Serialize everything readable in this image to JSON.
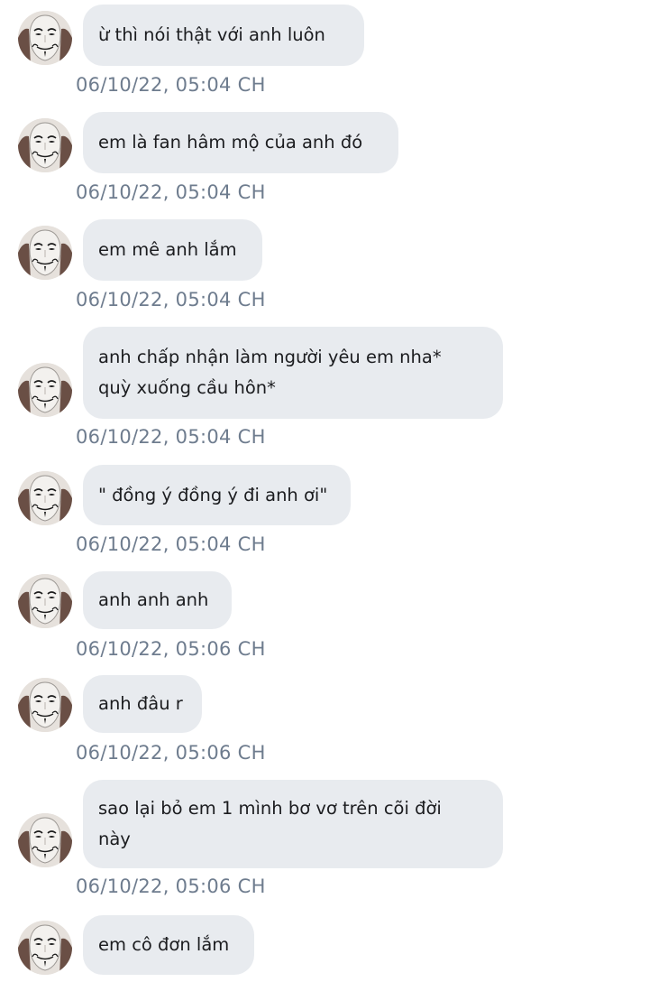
{
  "messages": [
    {
      "text": "ừ thì nói thật với anh luôn",
      "time": "06/10/22,  05:04 CH"
    },
    {
      "text": "em là fan hâm mộ của anh đó",
      "time": "06/10/22,  05:04 CH"
    },
    {
      "text": "em mê anh lắm",
      "time": "06/10/22,  05:04 CH"
    },
    {
      "text": "anh chấp nhận làm người yêu em nha*\nquỳ xuống cầu hôn*",
      "time": "06/10/22,  05:04 CH"
    },
    {
      "text": "\" đồng ý đồng ý đi anh ơi\"",
      "time": "06/10/22,  05:04 CH"
    },
    {
      "text": "anh anh anh",
      "time": "06/10/22,  05:06 CH"
    },
    {
      "text": "anh đâu r",
      "time": "06/10/22,  05:06 CH"
    },
    {
      "text": "sao lại bỏ em 1 mình bơ vơ trên cõi đời\nnày",
      "time": "06/10/22,  05:06 CH"
    },
    {
      "text": "em cô đơn lắm",
      "time": ""
    }
  ],
  "avatar_icon": "guy-fawkes-mask-icon",
  "colors": {
    "bubble_bg": "#e8ebef",
    "text": "#1b1c1f",
    "timestamp": "#6e7c8e"
  }
}
